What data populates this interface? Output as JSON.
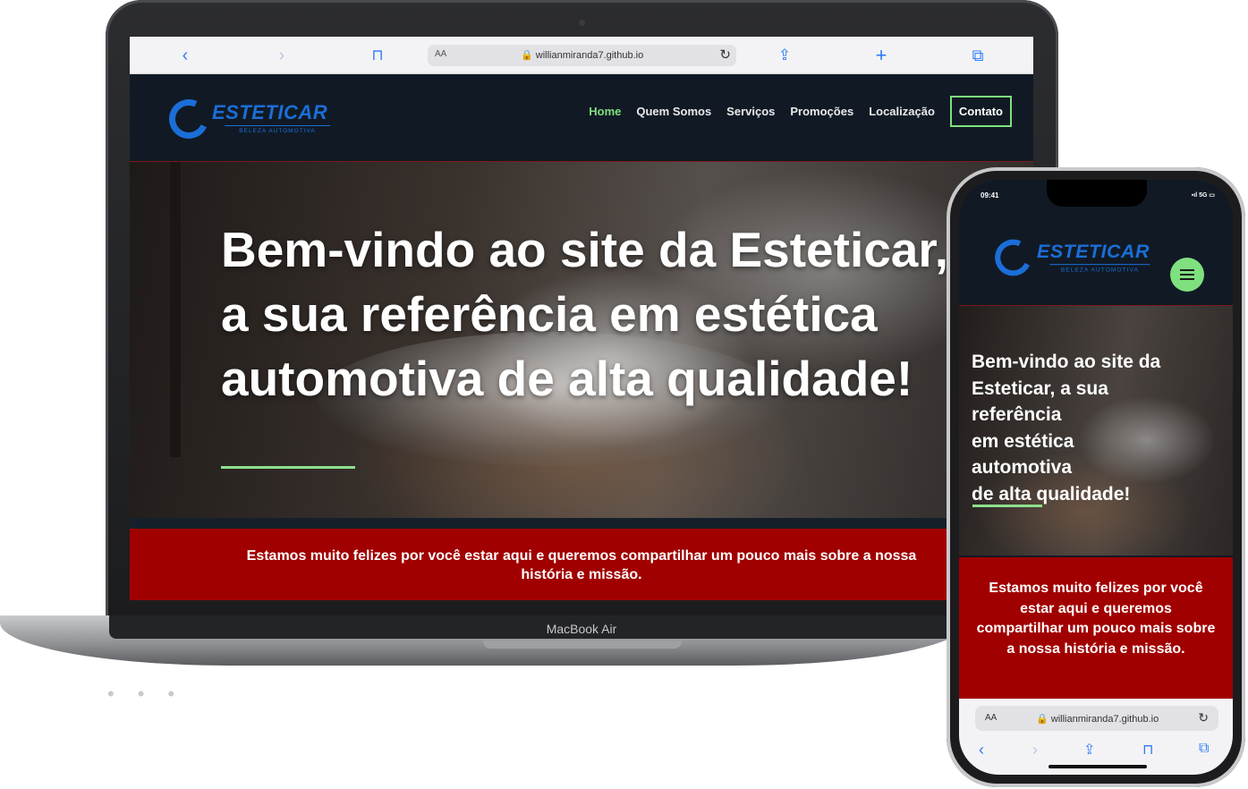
{
  "laptop": {
    "brand": "MacBook Air",
    "browser": {
      "aa_label": "AA",
      "url": "🔒 willianmiranda7.github.io",
      "reload_glyph": "↻",
      "back_glyph": "‹",
      "forward_glyph": "›",
      "bookmarks_glyph": "⊓",
      "share_glyph": "⇪",
      "new_tab_glyph": "+",
      "tabs_glyph": "⧉"
    },
    "site": {
      "logo_text": "ESTETICAR",
      "logo_sub": "BELEZA AUTOMOTIVA",
      "nav": [
        {
          "label": "Home"
        },
        {
          "label": "Quem Somos"
        },
        {
          "label": "Serviços"
        },
        {
          "label": "Promoções"
        },
        {
          "label": "Localização"
        },
        {
          "label": "Contato"
        }
      ],
      "hero_title": "Bem-vindo ao site da Esteticar, a sua referência em estética automotiva de alta qualidade!",
      "intro": "Estamos muito felizes por você estar aqui e queremos compartilhar um pouco mais sobre a nossa história e missão."
    }
  },
  "phone": {
    "status_time": "09:41",
    "status_icons": "▪ıl 5G ▭",
    "site": {
      "logo_text": "ESTETICAR",
      "logo_sub": "BELEZA AUTOMOTIVA",
      "hero_title_lines": [
        "Bem-vindo ao site da",
        "Esteticar, a sua",
        "referência",
        "em estética",
        "automotiva",
        "de alta qualidade!"
      ],
      "intro": "Estamos muito felizes por você estar aqui e queremos compartilhar um pouco mais sobre a nossa história e missão."
    },
    "browser": {
      "aa_label": "AA",
      "url": "🔒 willianmiranda7.github.io",
      "reload_glyph": "↻",
      "back_glyph": "‹",
      "forward_glyph": "›",
      "share_glyph": "⇪",
      "bookmarks_glyph": "⊓",
      "tabs_glyph": "⧉"
    }
  },
  "colors": {
    "accent_green": "#7fe07f",
    "brand_blue": "#1b6ed8",
    "band_red": "#a10000",
    "nav_bg": "#111a24"
  }
}
